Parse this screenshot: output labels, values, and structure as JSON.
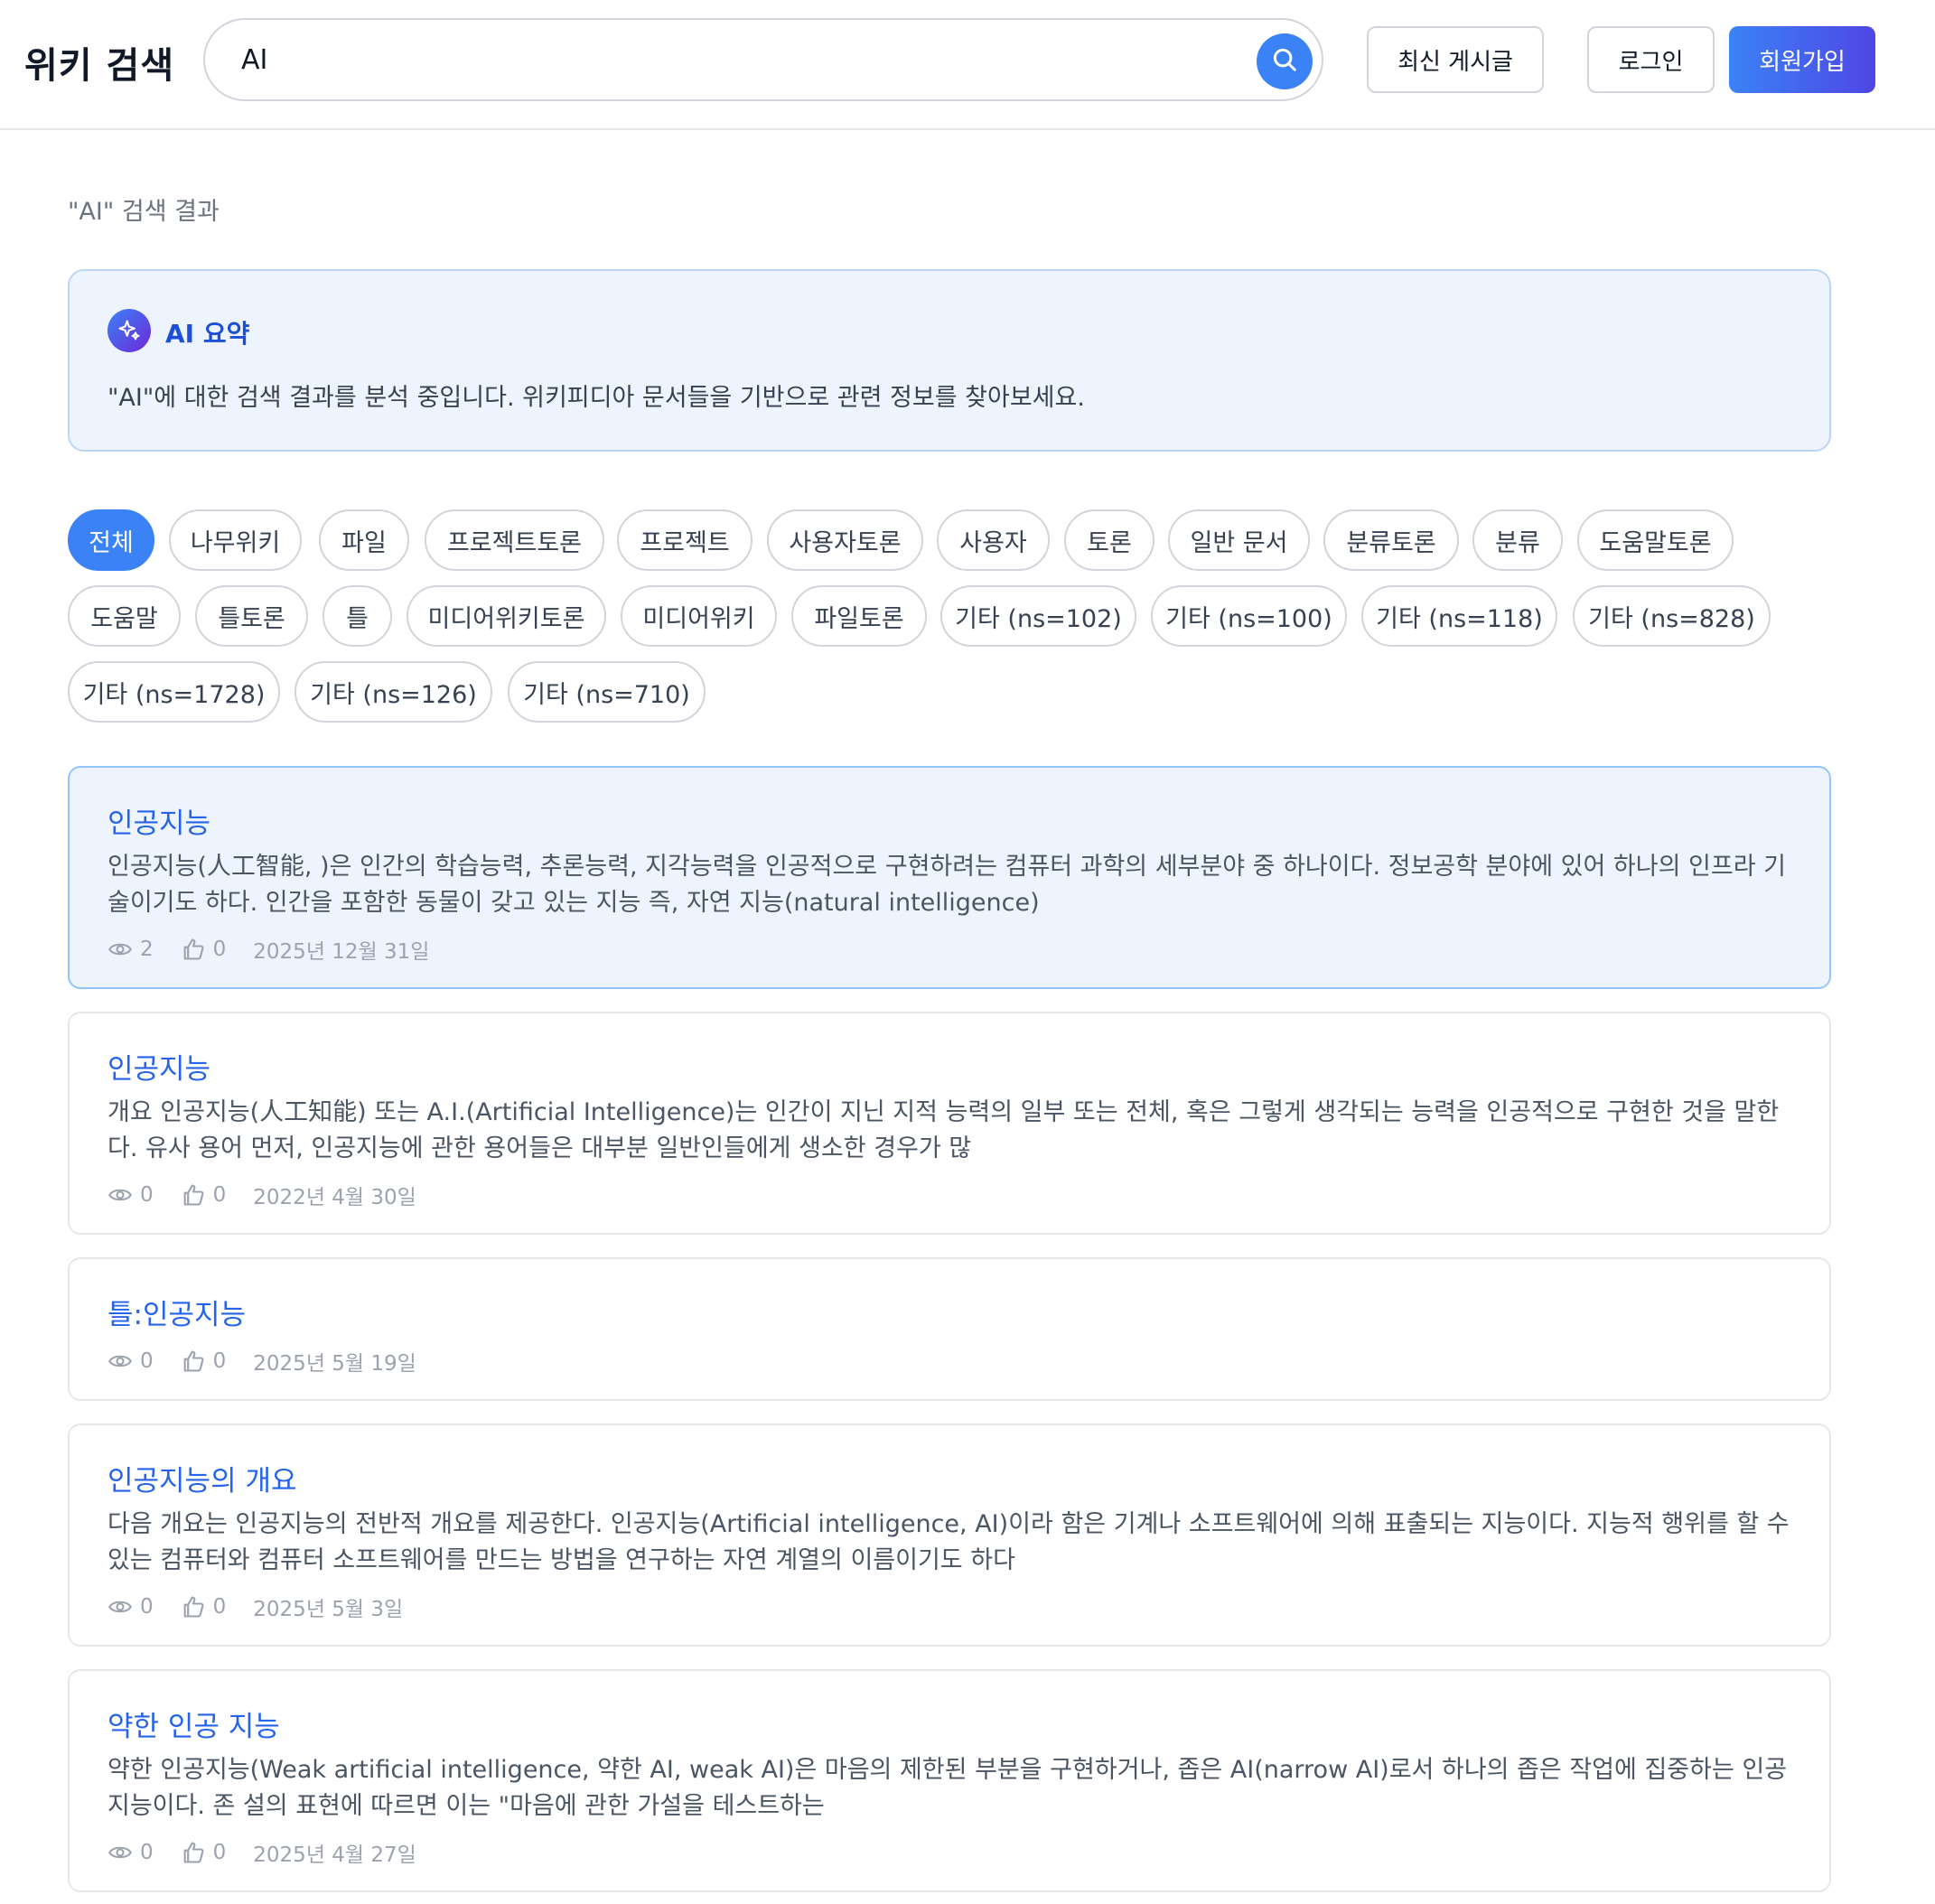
{
  "header": {
    "logo": "위키 검색",
    "search_value": "AI",
    "latest_label": "최신 게시글",
    "login_label": "로그인",
    "signup_label": "회원가입"
  },
  "results_title": "\"AI\" 검색 결과",
  "ai_summary": {
    "title": "AI 요약",
    "text": "\"AI\"에 대한 검색 결과를 분석 중입니다. 위키피디아 문서들을 기반으로 관련 정보를 찾아보세요."
  },
  "filters": [
    "전체",
    "나무위키",
    "파일",
    "프로젝트토론",
    "프로젝트",
    "사용자토론",
    "사용자",
    "토론",
    "일반 문서",
    "분류토론",
    "분류",
    "도움말토론",
    "도움말",
    "틀토론",
    "틀",
    "미디어위키토론",
    "미디어위키",
    "파일토론",
    "기타 (ns=102)",
    "기타 (ns=100)",
    "기타 (ns=118)",
    "기타 (ns=828)",
    "기타 (ns=1728)",
    "기타 (ns=126)",
    "기타 (ns=710)"
  ],
  "active_filter": "전체",
  "results": [
    {
      "title": "인공지능",
      "snippet": "인공지능(人工智能, )은 인간의 학습능력, 추론능력, 지각능력을 인공적으로 구현하려는 컴퓨터 과학의 세부분야 중 하나이다. 정보공학 분야에 있어 하나의 인프라 기술이기도 하다. 인간을 포함한 동물이 갖고 있는 지능 즉, 자연 지능(natural intelligence)",
      "views": "2",
      "likes": "0",
      "date": "2025년 12월 31일"
    },
    {
      "title": "인공지능",
      "snippet": "개요 인공지능(人工知能) 또는 A.I.(Artificial Intelligence)는 인간이 지닌 지적 능력의 일부 또는 전체, 혹은 그렇게 생각되는 능력을 인공적으로 구현한 것을 말한다. 유사 용어 먼저, 인공지능에 관한 용어들은 대부분 일반인들에게 생소한 경우가 많",
      "views": "0",
      "likes": "0",
      "date": "2022년 4월 30일"
    },
    {
      "title": "틀:인공지능",
      "snippet": "",
      "views": "0",
      "likes": "0",
      "date": "2025년 5월 19일"
    },
    {
      "title": "인공지능의 개요",
      "snippet": "다음 개요는 인공지능의 전반적 개요를 제공한다. 인공지능(Artificial intelligence, AI)이라 함은 기계나 소프트웨어에 의해 표출되는 지능이다. 지능적 행위를 할 수 있는 컴퓨터와 컴퓨터 소프트웨어를 만드는 방법을 연구하는 자연 계열의 이름이기도 하다",
      "views": "0",
      "likes": "0",
      "date": "2025년 5월 3일"
    },
    {
      "title": "약한 인공 지능",
      "snippet": "약한 인공지능(Weak artificial intelligence, 약한 AI, weak AI)은 마음의 제한된 부분을 구현하거나, 좁은 AI(narrow AI)로서 하나의 좁은 작업에 집중하는 인공지능이다. 존 설의 표현에 따르면 이는 \"마음에 관한 가설을 테스트하는",
      "views": "0",
      "likes": "0",
      "date": "2025년 4월 27일"
    }
  ],
  "colors": {
    "accent": "#3b82f6",
    "link": "#2563eb",
    "summary_bg": "#eef4fe"
  }
}
